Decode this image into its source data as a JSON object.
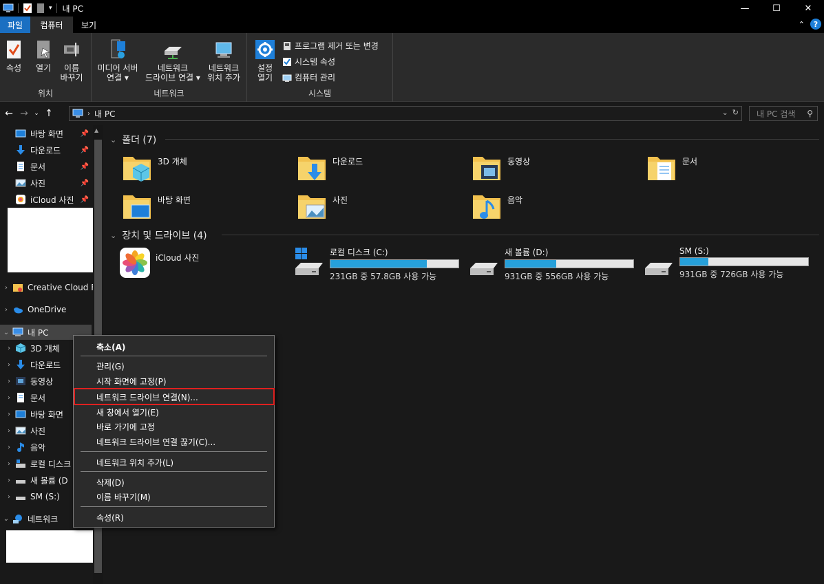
{
  "window": {
    "title": "내 PC"
  },
  "tabs": [
    {
      "label": "파일"
    },
    {
      "label": "컴퓨터"
    },
    {
      "label": "보기"
    }
  ],
  "ribbon": {
    "location": {
      "label": "위치",
      "properties": "속성",
      "open": "열기",
      "rename_1": "이름",
      "rename_2": "바꾸기"
    },
    "network": {
      "label": "네트워크",
      "media_1": "미디어 서버",
      "media_2": "연결 ▾",
      "map_1": "네트워크",
      "map_2": "드라이브 연결 ▾",
      "addloc_1": "네트워크",
      "addloc_2": "위치 추가"
    },
    "system": {
      "label": "시스템",
      "settings_1": "설정",
      "settings_2": "열기",
      "uninstall": "프로그램 제거 또는 변경",
      "sysprops": "시스템 속성",
      "manage": "컴퓨터 관리"
    }
  },
  "address": {
    "path": "내 PC",
    "search_placeholder": "내 PC 검색"
  },
  "nav": {
    "quick": [
      {
        "label": "바탕 화면"
      },
      {
        "label": "다운로드"
      },
      {
        "label": "문서"
      },
      {
        "label": "사진"
      },
      {
        "label": "iCloud 사진"
      }
    ],
    "creative": "Creative Cloud Fil",
    "onedrive": "OneDrive",
    "thispc": "내 PC",
    "pc_children": [
      {
        "label": "3D 개체"
      },
      {
        "label": "다운로드"
      },
      {
        "label": "동영상"
      },
      {
        "label": "문서"
      },
      {
        "label": "바탕 화면"
      },
      {
        "label": "사진"
      },
      {
        "label": "음악"
      },
      {
        "label": "로컬 디스크"
      },
      {
        "label": "새 볼륨 (D"
      },
      {
        "label": "SM (S:)"
      }
    ],
    "network": "네트워크"
  },
  "content": {
    "folders_header": "폴더 (7)",
    "folders": [
      {
        "name": "3D 개체"
      },
      {
        "name": "다운로드"
      },
      {
        "name": "동영상"
      },
      {
        "name": "문서"
      },
      {
        "name": "바탕 화면"
      },
      {
        "name": "사진"
      },
      {
        "name": "음악"
      }
    ],
    "drives_header": "장치 및 드라이브 (4)",
    "icloud": "iCloud 사진",
    "drives": [
      {
        "name": "로컬 디스크 (C:)",
        "info": "231GB 중 57.8GB 사용 가능",
        "used_fraction": 0.75
      },
      {
        "name": "새 볼륨 (D:)",
        "info": "931GB 중 556GB 사용 가능",
        "used_fraction": 0.4
      },
      {
        "name": "SM (S:)",
        "info": "931GB 중 726GB 사용 가능",
        "used_fraction": 0.22
      }
    ]
  },
  "context_menu": {
    "collapse": "축소(A)",
    "manage": "관리(G)",
    "pin_start": "시작 화면에 고정(P)",
    "map_drive": "네트워크 드라이브 연결(N)...",
    "open_new": "새 창에서 열기(E)",
    "pin_quick": "바로 가기에 고정",
    "disconnect": "네트워크 드라이브 연결 끊기(C)...",
    "add_netloc": "네트워크 위치 추가(L)",
    "delete": "삭제(D)",
    "rename": "이름 바꾸기(M)",
    "properties": "속성(R)"
  },
  "colors": {
    "accent": "#1a6fc2",
    "bar_fill": "#26a0da",
    "highlight_box": "#e0201f"
  }
}
